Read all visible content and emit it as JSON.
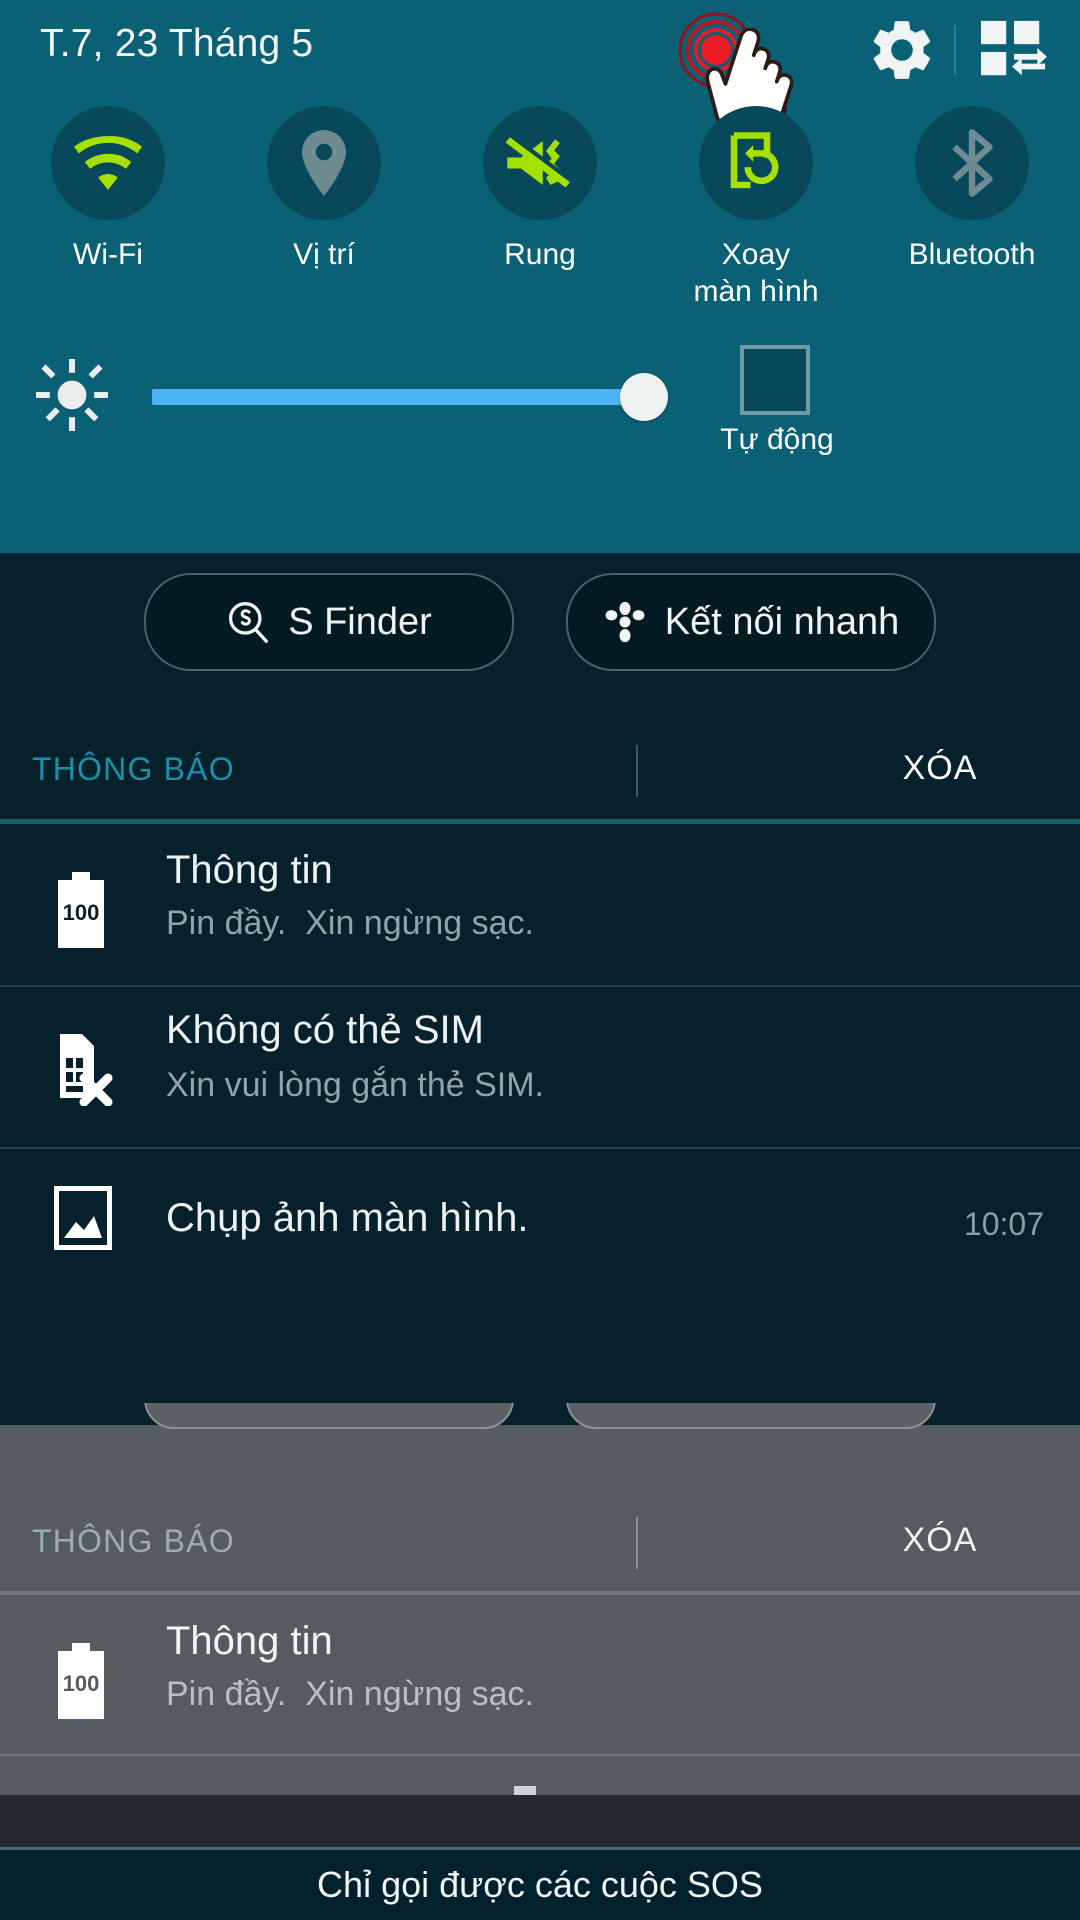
{
  "status_bar": {
    "date": "T.7, 23 Tháng 5",
    "settings_icon": "gear-icon",
    "edit_icon": "quick-settings-edit-icon",
    "tap_indicator": "tap-ripple-indicator",
    "cursor": "hand-cursor"
  },
  "quick_toggles": [
    {
      "label": "Wi-Fi",
      "icon": "wifi-icon",
      "active": true
    },
    {
      "label": "Vị trí",
      "icon": "location-pin-icon",
      "active": false
    },
    {
      "label": "Rung",
      "icon": "vibrate-icon",
      "active": true
    },
    {
      "label": "Xoay\nmàn hình",
      "icon": "screen-rotate-icon",
      "active": true
    },
    {
      "label": "Bluetooth",
      "icon": "bluetooth-icon",
      "active": false
    }
  ],
  "brightness": {
    "icon": "brightness-icon",
    "value_percent": 89,
    "auto_label": "Tự động",
    "auto_checked": false
  },
  "shortcuts": [
    {
      "label": "S Finder",
      "icon": "s-finder-icon"
    },
    {
      "label": "Kết nối nhanh",
      "icon": "quick-connect-icon"
    }
  ],
  "notifications_section": {
    "title": "THÔNG BÁO",
    "clear_label": "XÓA"
  },
  "notifications": [
    {
      "icon": "battery-100-icon",
      "icon_text": "100",
      "title": "Thông tin",
      "body": "Pin đầy.  Xin ngừng sạc.",
      "time": ""
    },
    {
      "icon": "no-sim-card-icon",
      "icon_text": "",
      "title": "Không có thẻ SIM",
      "body": "Xin vui lòng gắn thẻ SIM.",
      "time": ""
    },
    {
      "icon": "screenshot-image-icon",
      "icon_text": "",
      "title": "Chụp ảnh màn hình.",
      "body": "",
      "time": "10:07"
    }
  ],
  "overlay_panel": {
    "title": "THÔNG BÁO",
    "clear_label": "XÓA",
    "notification": {
      "icon": "battery-100-icon",
      "icon_text": "100",
      "title": "Thông tin",
      "body": "Pin đầy.  Xin ngừng sạc."
    }
  },
  "bottom_bar": {
    "text": "Chỉ gọi được các cuộc SOS"
  },
  "colors": {
    "panel_teal": "#0a6176",
    "toggle_circle": "#07485a",
    "accent_green": "#a6e000",
    "inactive_gray": "#6e8b92",
    "notif_panel": "#06212b",
    "section_title": "#1a90ab",
    "slider_blue": "#4fb3f3",
    "overlay_gray": "#555b5e"
  }
}
